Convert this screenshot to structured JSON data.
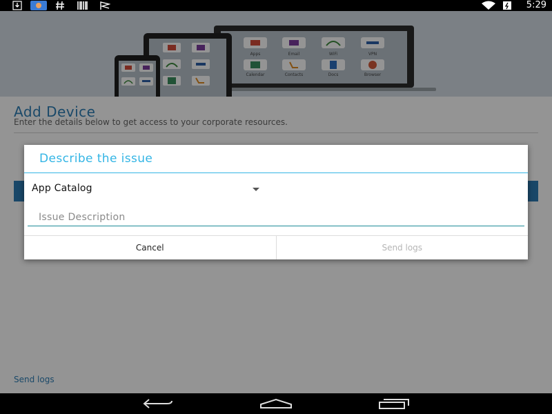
{
  "status_bar": {
    "time": "5:29",
    "icons": [
      "download-icon",
      "photo-icon",
      "hash-icon",
      "barcode-icon",
      "flag-icon",
      "wifi-icon",
      "battery-icon"
    ]
  },
  "hero": {
    "device_tiles": [
      "Apps",
      "Email",
      "WiFi",
      "VPN",
      "Calendar",
      "Contacts",
      "Docs",
      "Browser"
    ]
  },
  "page": {
    "title": "Add Device",
    "subtitle": "Enter the details below to get access to your corporate resources.",
    "send_logs_link": "Send logs"
  },
  "dialog": {
    "title": "Describe the issue",
    "category_selected": "App Catalog",
    "issue_placeholder": "Issue Description",
    "cancel_label": "Cancel",
    "send_label": "Send logs"
  },
  "colors": {
    "dialog_accent": "#33b5e5",
    "input_underline": "#1b8a97",
    "app_primary": "#2e7eb5"
  },
  "nav_bar": {
    "icons": [
      "back-icon",
      "home-icon",
      "recents-icon"
    ]
  }
}
